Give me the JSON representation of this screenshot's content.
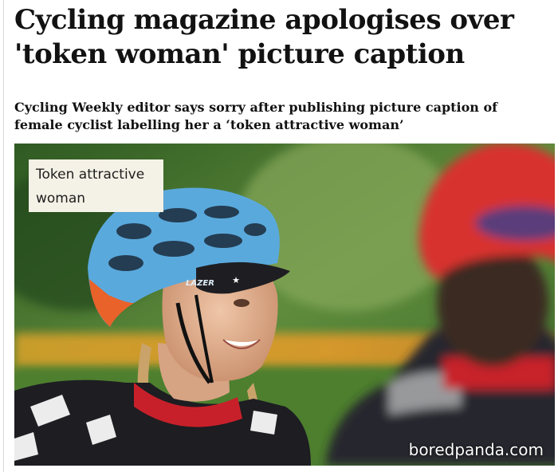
{
  "article": {
    "headline": "Cycling magazine apologises over 'token woman' picture caption",
    "standfirst": "Cycling Weekly editor says sorry after publishing picture caption of female cyclist labelling her a ‘token attractive woman’"
  },
  "photo": {
    "caption_label": "Token attractive woman",
    "helmet_brand": "LAZER"
  },
  "watermark": "boredpanda.com",
  "colors": {
    "text": "#121212",
    "caption_bg": "#f4f1e6",
    "helmet_blue": "#5aa9dd",
    "helmet_red": "#d8312f",
    "jersey_red": "#c8202a"
  }
}
